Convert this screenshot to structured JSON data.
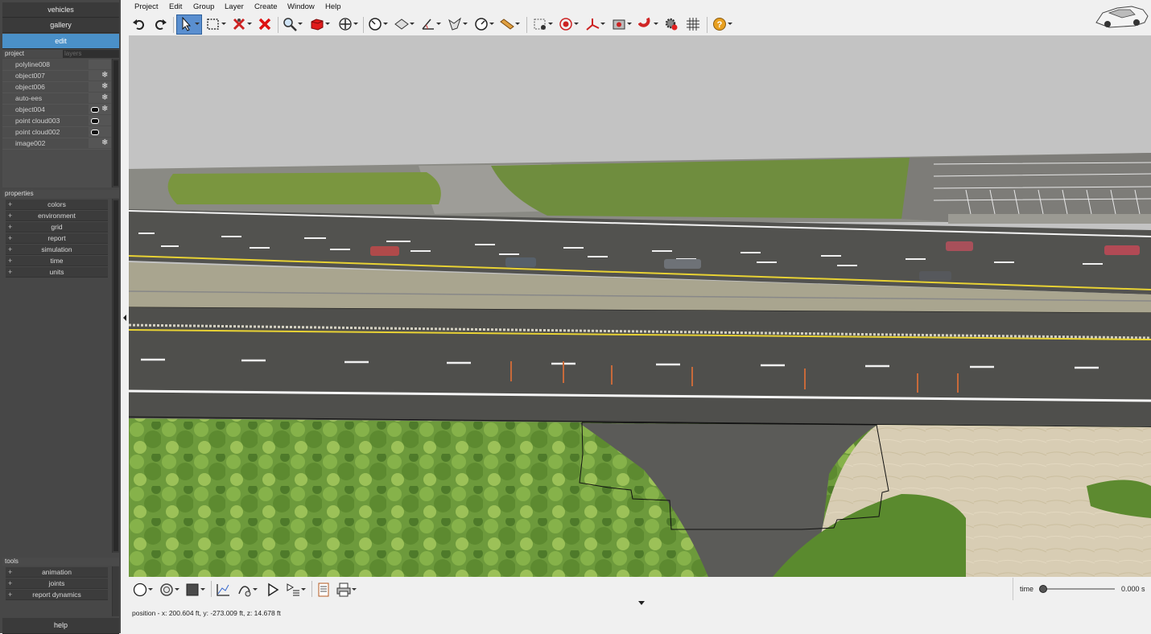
{
  "nav": {
    "vehicles": "vehicles",
    "gallery": "gallery",
    "edit": "edit",
    "help": "help"
  },
  "project_panel": {
    "tabs": [
      "project",
      "layers"
    ],
    "items": [
      {
        "name": "polyline008",
        "icon1": "",
        "icon2": ""
      },
      {
        "name": "object007",
        "icon1": "",
        "icon2": "snowflake-icon"
      },
      {
        "name": "object006",
        "icon1": "",
        "icon2": "snowflake-icon"
      },
      {
        "name": "auto-ees",
        "icon1": "",
        "icon2": "snowflake-icon"
      },
      {
        "name": "object004",
        "icon1": "eye-icon",
        "icon2": "snowflake-icon"
      },
      {
        "name": "point cloud003",
        "icon1": "eye-icon",
        "icon2": ""
      },
      {
        "name": "point cloud002",
        "icon1": "eye-icon",
        "icon2": ""
      },
      {
        "name": "image002",
        "icon1": "",
        "icon2": "snowflake-icon"
      }
    ]
  },
  "properties_panel": {
    "title": "properties",
    "items": [
      "colors",
      "environment",
      "grid",
      "report",
      "simulation",
      "time",
      "units"
    ]
  },
  "tools_panel": {
    "title": "tools",
    "items": [
      "animation",
      "joints",
      "report dynamics"
    ]
  },
  "menu": [
    "Project",
    "Edit",
    "Group",
    "Layer",
    "Create",
    "Window",
    "Help"
  ],
  "toolbar_icons": [
    "undo-icon",
    "redo-icon",
    "select-arrow-icon",
    "box-select-icon",
    "delete-points-icon",
    "delete-icon",
    "zoom-icon",
    "solid-cube-icon",
    "pan-icon",
    "measure-gauge-icon",
    "surface-icon",
    "angle-icon",
    "project-icon",
    "speed-gauge-icon",
    "ruler-icon",
    "crop-icon",
    "target-icon",
    "axes-icon",
    "camera-icon",
    "magnet-icon",
    "gear-icon",
    "grid-icon",
    "help-icon"
  ],
  "bottom_toolbar_icons": [
    "sphere-icon",
    "material-icon",
    "color-swatch-icon",
    "graph-icon",
    "path-icon",
    "play-icon",
    "sequence-icon",
    "report-icon",
    "print-icon"
  ],
  "status": {
    "position": "position - x: 200.604 ft, y: -273.009 ft, z: 14.678 ft"
  },
  "timeline": {
    "label": "time",
    "value": "0.000 s",
    "fraction": 0
  },
  "colors": {
    "active_nav": "#4a90c8",
    "panel_bg": "#474747",
    "toolbar_bg": "#f0f0f0"
  }
}
